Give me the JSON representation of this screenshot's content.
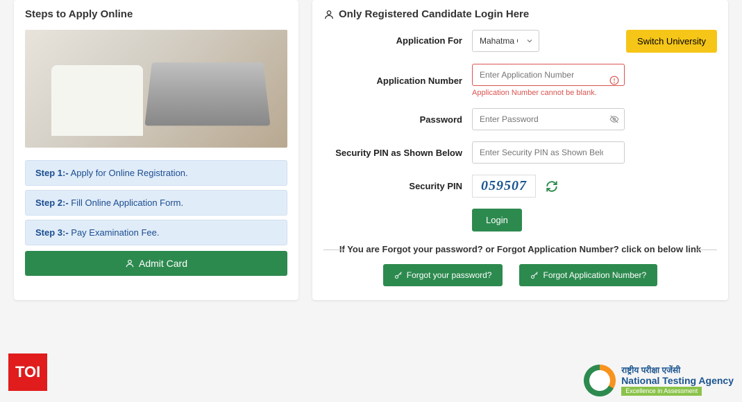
{
  "left": {
    "title": "Steps to Apply Online",
    "steps": [
      {
        "label": "Step 1:-",
        "text": " Apply for Online Registration."
      },
      {
        "label": "Step 2:-",
        "text": " Fill Online Application Form."
      },
      {
        "label": "Step 3:-",
        "text": " Pay Examination Fee."
      }
    ],
    "admit_card": "Admit Card"
  },
  "right": {
    "title": "Only Registered Candidate Login Here",
    "labels": {
      "application_for": "Application For",
      "application_number": "Application Number",
      "password": "Password",
      "security_pin_below": "Security PIN as Shown Below",
      "security_pin": "Security PIN"
    },
    "university_selected": "Mahatma Gandhi Central University",
    "switch_university": "Switch University",
    "placeholders": {
      "application_number": "Enter Application Number",
      "password": "Enter Password",
      "security_pin": "Enter Security PIN as Shown Below"
    },
    "errors": {
      "application_number": "Application Number cannot be blank."
    },
    "captcha": "059507",
    "login": "Login",
    "forgot_prompt": "If You are Forgot your password? or Forgot Application Number? click on below link",
    "forgot_password": "Forgot your password?",
    "forgot_app_number": "Forgot Application Number?"
  },
  "footer": {
    "toi": "TOI",
    "nta_hindi": "राष्ट्रीय परीक्षा एजेंसी",
    "nta_eng": "National Testing Agency",
    "nta_tag": "Excellence in Assessment"
  }
}
